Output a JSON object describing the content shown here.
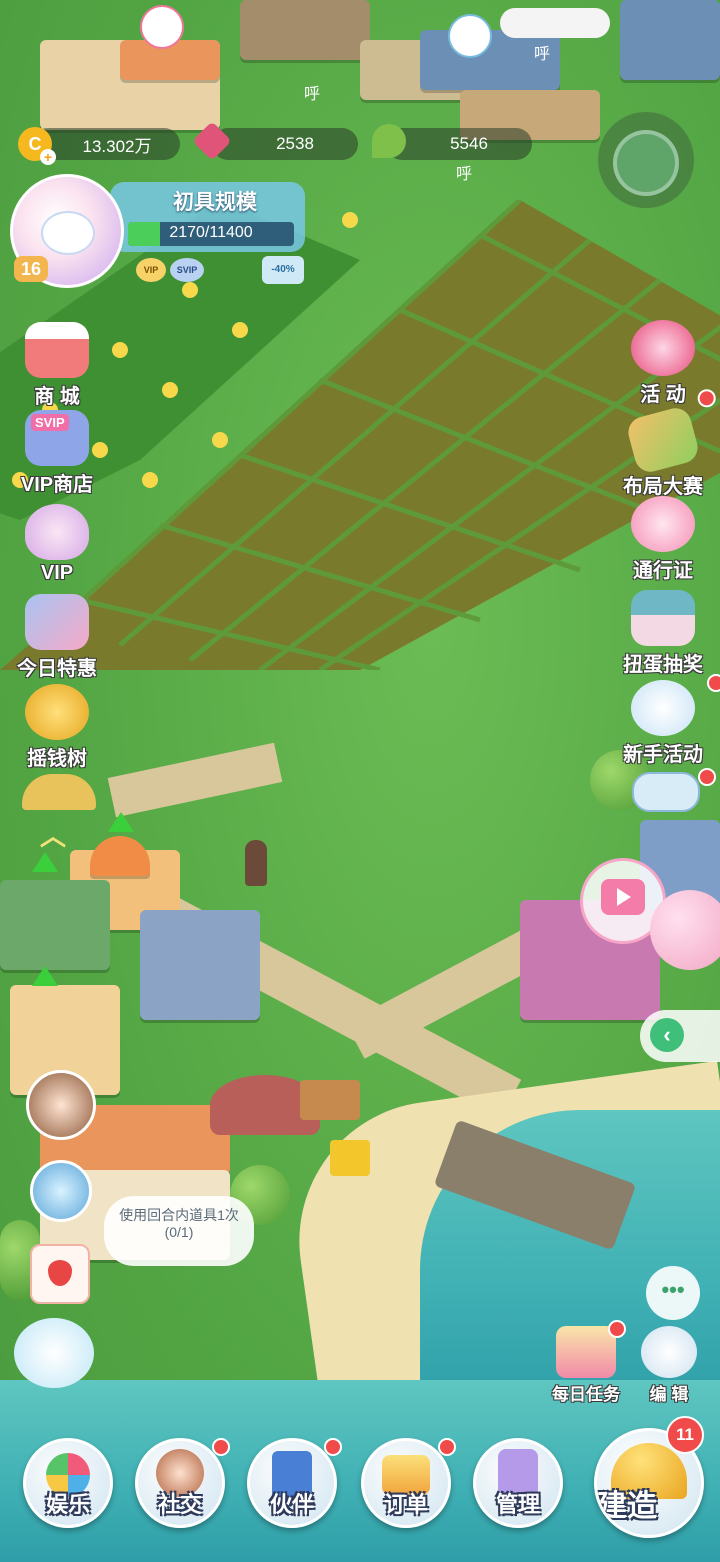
{
  "resources": {
    "gold": "13.302万",
    "gems": "2538",
    "sprouts": "5546"
  },
  "player": {
    "level": "16",
    "title": "初具规模",
    "exp": "2170/11400",
    "exp_progress": 0.19,
    "vip_badge": "VIP",
    "svip_badge": "SVIP",
    "discount_badge": "-40%"
  },
  "left_menu": {
    "shop": "商 城",
    "vip_shop": "VIP商店",
    "vip_badge": "SVIP",
    "vip": "VIP",
    "today_deal": "今日特惠",
    "money_tree": "摇钱树"
  },
  "right_menu": {
    "events": "活 动",
    "layout_contest": "布局大赛",
    "pass": "通行证",
    "gacha": "扭蛋抽奖",
    "newbie": "新手活动"
  },
  "task_bubble": {
    "text": "使用回合内道具1次",
    "progress": "(0/1)"
  },
  "tools": {
    "daily_tasks": "每日任务",
    "edit": "编 辑"
  },
  "bottom_nav": {
    "entertainment": "娱乐",
    "social": "社交",
    "partner": "伙伴",
    "orders": "订单",
    "manage": "管理",
    "build": "建造",
    "build_badge": "11"
  },
  "world_text": {
    "snore1": "呼",
    "snore2": "呼",
    "snore3": "呼"
  },
  "colors": {
    "gem": "#e0547a",
    "gold": "#f5b81f",
    "badge_red": "#f04a4a",
    "exp_green": "#4ccf5a"
  }
}
